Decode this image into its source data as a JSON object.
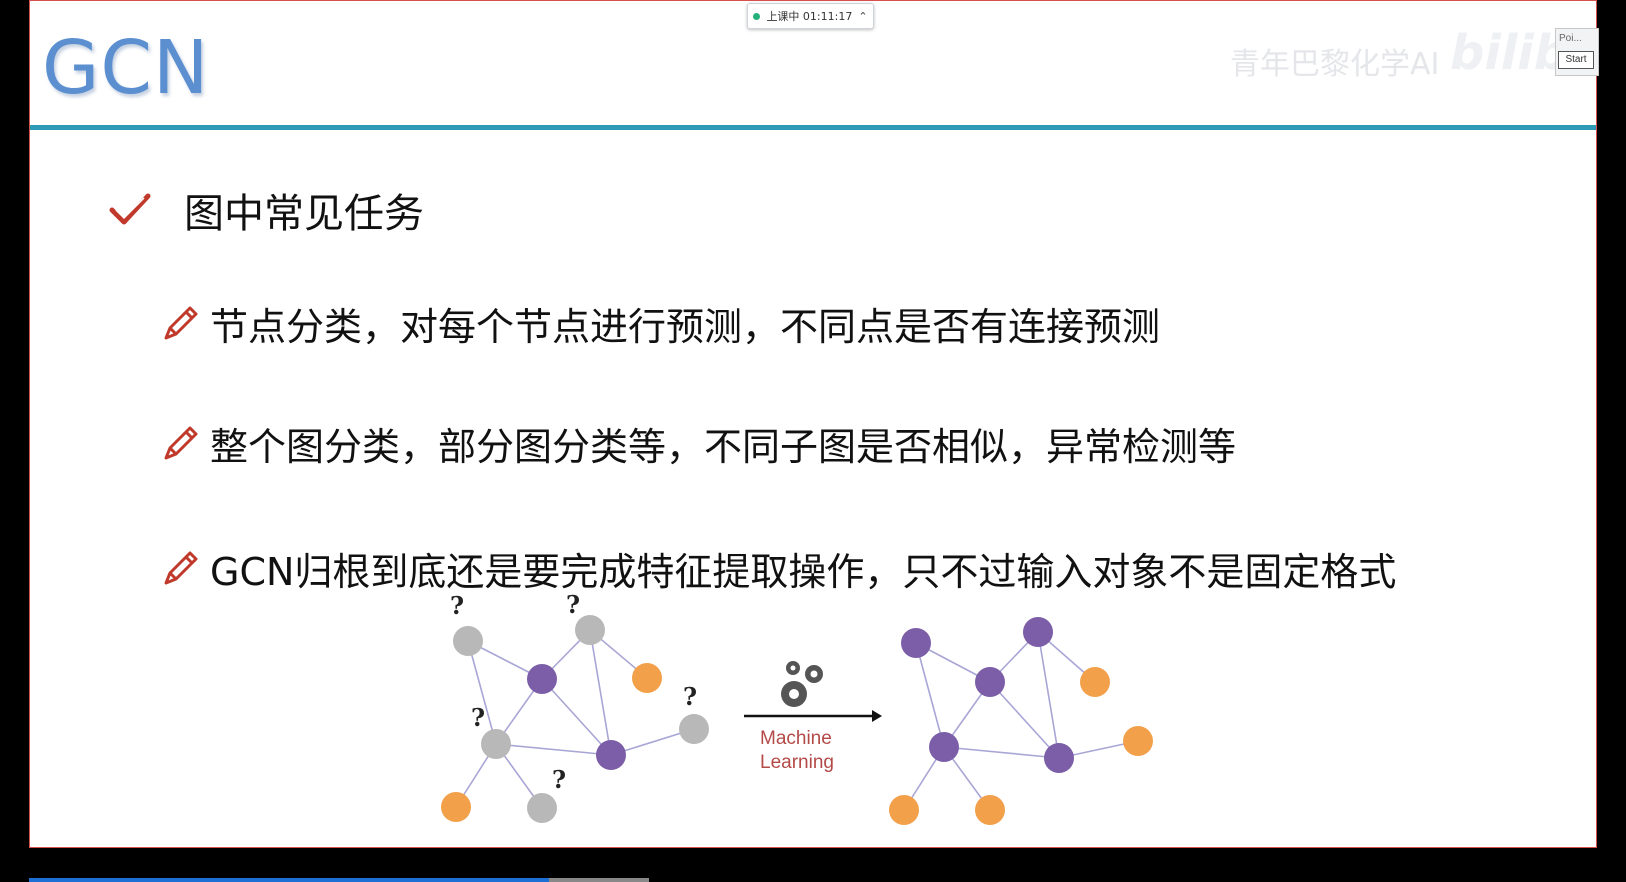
{
  "status": {
    "text": "上课中 01:11:17"
  },
  "slide": {
    "title": "GCN",
    "watermark": "青年巴黎化学AI",
    "watermark_logo": "bilibili",
    "heading": "图中常见任务",
    "bullets": [
      "节点分类，对每个节点进行预测，不同点是否有连接预测",
      "整个图分类，部分图分类等，不同子图是否相似，异常检测等",
      "GCN归根到底还是要完成特征提取操作，只不过输入对象不是固定格式"
    ]
  },
  "diagram": {
    "question_mark": "?",
    "ml_label_line1": "Machine",
    "ml_label_line2": "Learning"
  },
  "mini_panel": {
    "title": "Poi...",
    "button": "Start"
  },
  "colors": {
    "title": "#5b8fd0",
    "rule": "#2e9ab6",
    "purple": "#7b5ea7",
    "gray": "#b8b8b8",
    "orange": "#f2a04a",
    "check": "#c0392b"
  }
}
